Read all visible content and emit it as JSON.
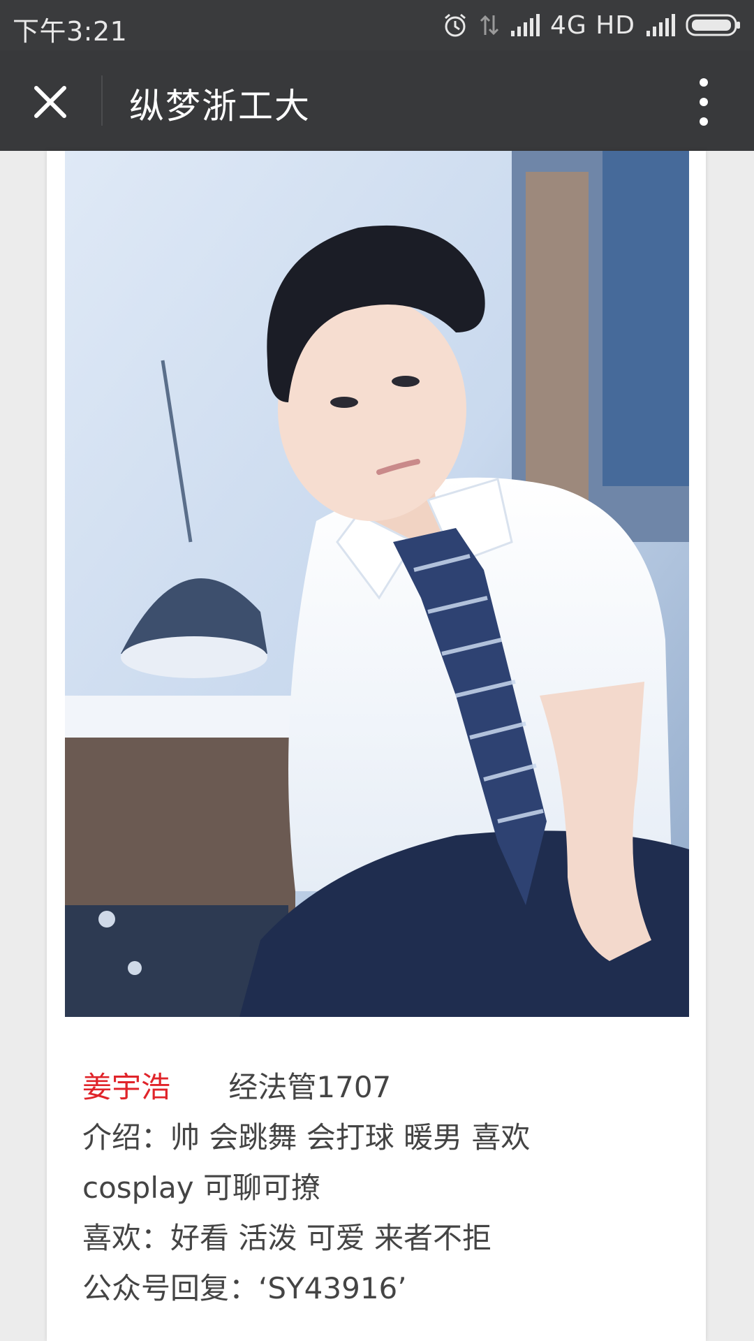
{
  "status_bar": {
    "time": "下午3:21",
    "network": "4G HD",
    "icons": [
      "alarm-icon",
      "data-arrows-icon",
      "signal-icon",
      "signal-icon",
      "battery-icon"
    ]
  },
  "title_bar": {
    "title": "纵梦浙工大",
    "close_icon": "close-icon",
    "more_icon": "more-vertical-icon"
  },
  "profile": {
    "name": "姜宇浩",
    "major": "经法管1707",
    "intro_line1": "介绍：帅 会跳舞 会打球 暖男  喜欢",
    "intro_line2": "cosplay 可聊可撩",
    "likes": "喜欢：好看 活泼 可爱 来者不拒",
    "reply": "公众号回复：‘SY43916’"
  }
}
